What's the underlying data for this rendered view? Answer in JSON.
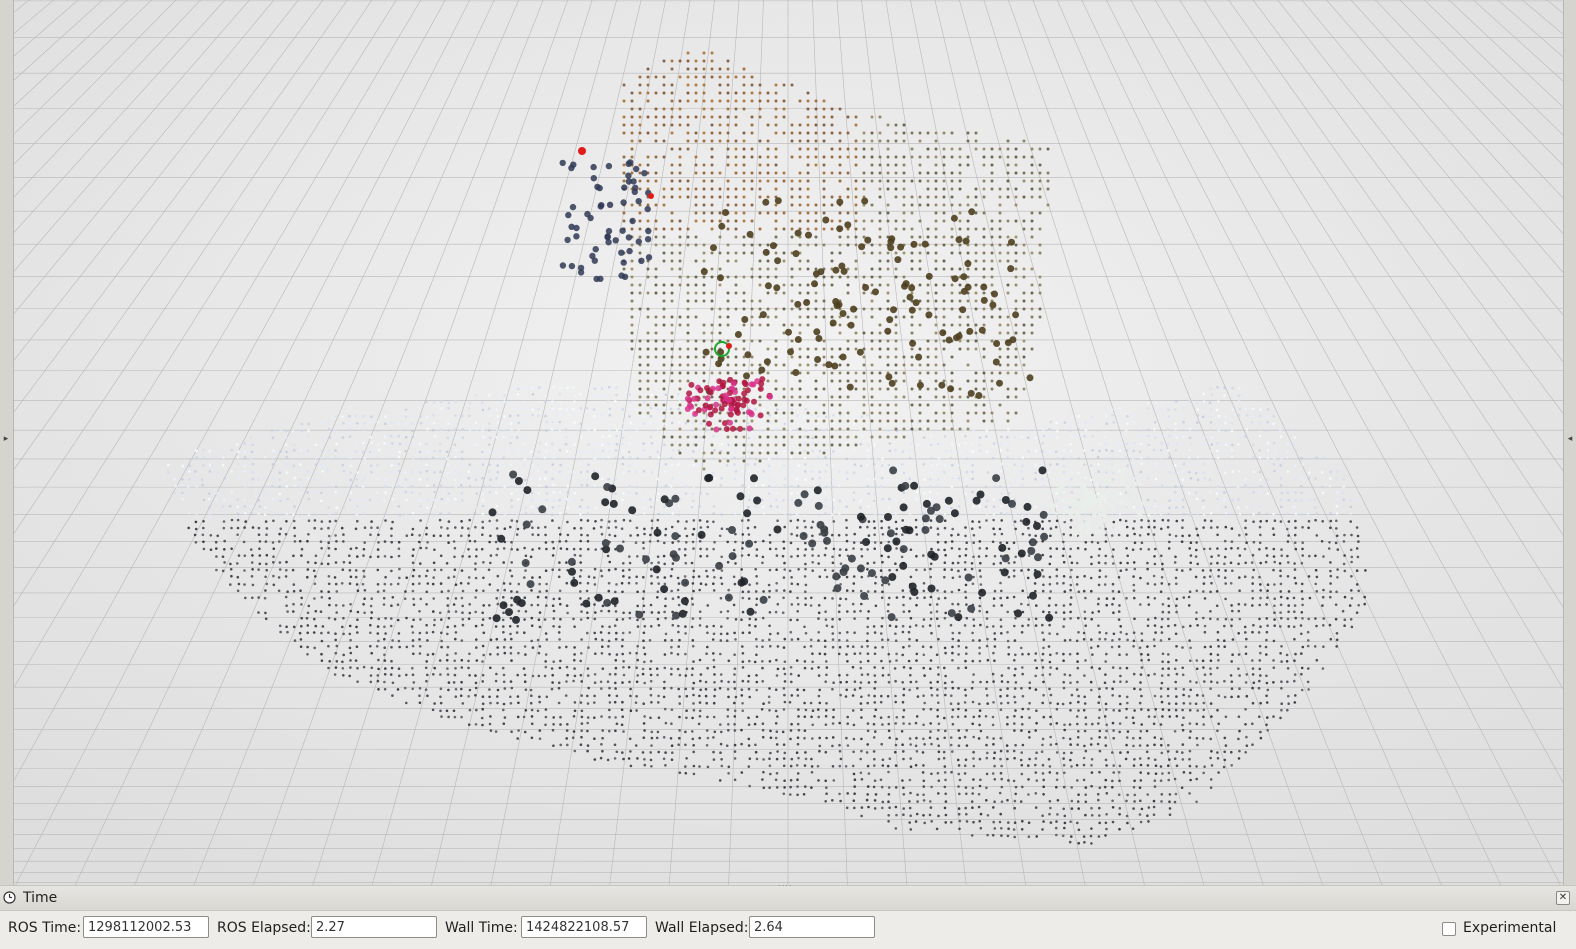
{
  "viewport": {
    "background": "#e9e9e9",
    "grid_color": "#b5b5b5"
  },
  "side_panels": {
    "left_arrow": "▸",
    "right_arrow": "◂"
  },
  "time_panel": {
    "title": "Time",
    "title_icon": "clock-icon",
    "close_icon": "close-icon",
    "fields": [
      {
        "label": "ROS Time:",
        "value": "1298112002.53"
      },
      {
        "label": "ROS Elapsed:",
        "value": "2.27"
      },
      {
        "label": "Wall Time:",
        "value": "1424822108.57"
      },
      {
        "label": "Wall Elapsed:",
        "value": "2.64"
      }
    ],
    "experimental": {
      "label": "Experimental",
      "checked": false
    }
  }
}
